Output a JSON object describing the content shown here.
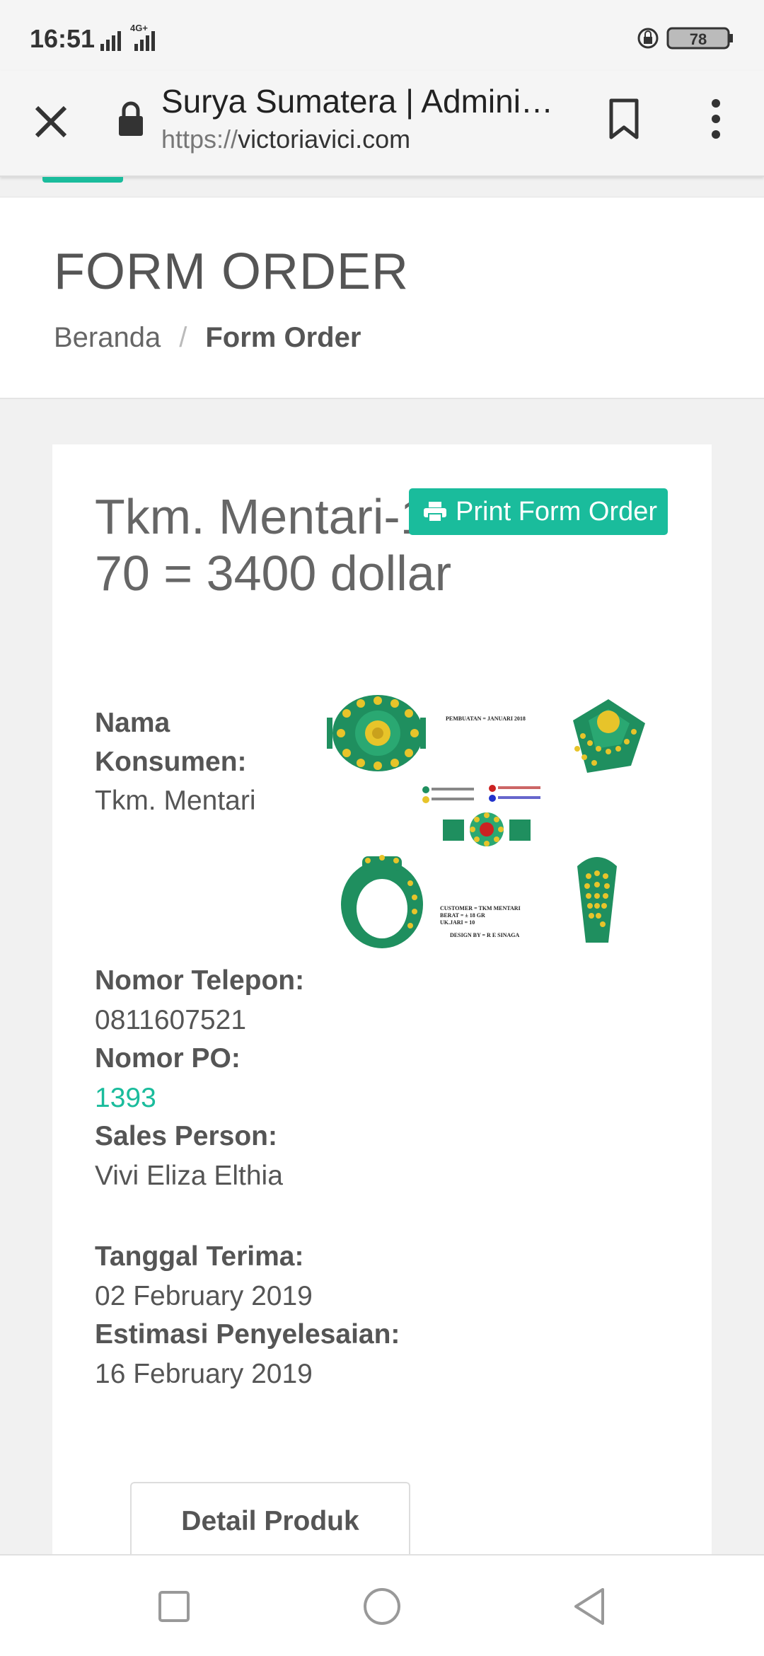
{
  "status_bar": {
    "time": "16:51",
    "network": "4G+",
    "battery": "78"
  },
  "browser": {
    "title": "Surya Sumatera | Admini…",
    "url_scheme": "https://",
    "url_host": "victoriavici.com"
  },
  "header": {
    "heading": "FORM ORDER",
    "breadcrumb": {
      "home": "Beranda",
      "separator": "/",
      "current": "Form Order"
    }
  },
  "order": {
    "title": "Tkm. Mentari-1393-Poin 70 = 3400 dollar",
    "print_label": "Print Form Order",
    "fields": {
      "customer_label": "Nama Konsumen:",
      "customer_value": "Tkm. Mentari",
      "phone_label": "Nomor Telepon:",
      "phone_value": "0811607521",
      "po_label": "Nomor PO:",
      "po_value": "1393",
      "sales_label": "Sales Person:",
      "sales_value": "Vivi Eliza Elthia",
      "received_label": "Tanggal Terima:",
      "received_value": "02 February 2019",
      "estimate_label": "Estimasi Penyelesaian:",
      "estimate_value": "16 February 2019"
    },
    "design_image_text": {
      "header": "PEMBUATAN = JANUARI 2018",
      "customer": "CUSTOMER = TKM MENTARI",
      "weight": "BERAT = ± 18 GR",
      "size": "UK.JARI = 10",
      "design_by": "DESIGN BY = R E SINAGA"
    },
    "tab_label": "Detail Produk"
  },
  "colors": {
    "accent": "#1abc9c",
    "ring_green": "#1f8f5f",
    "gem_yellow": "#e7c42a",
    "gem_red": "#cc2222"
  }
}
